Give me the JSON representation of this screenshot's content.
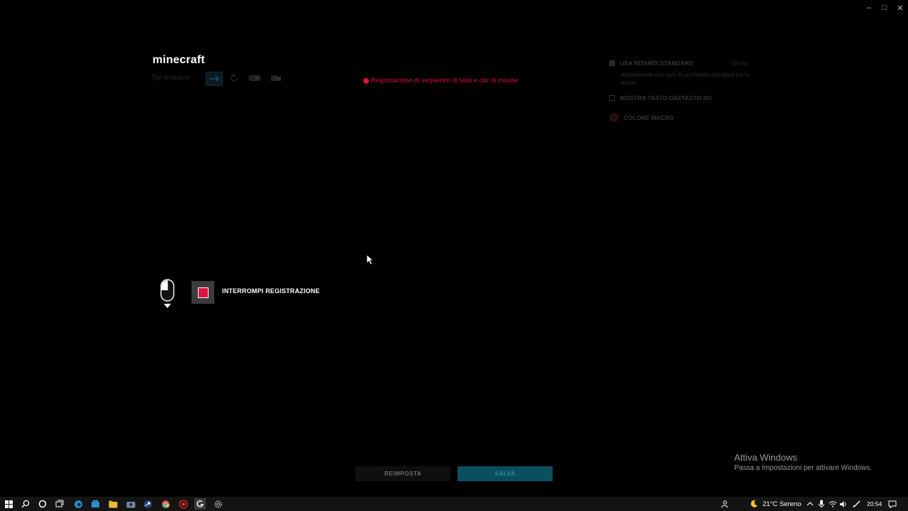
{
  "window": {
    "minimize_label": "–",
    "maximize_label": "□",
    "close_label": "✕"
  },
  "header": {
    "title": "minecraft",
    "macro_types_label": "Tipi di macro",
    "recording_status": "Registrazione di sequenze di tasti e clic di mouse"
  },
  "options": {
    "use_standard_delays_label": "USA RITARDI STANDARD",
    "use_standard_delays_checked": true,
    "delay_value": "50 ms",
    "standard_delays_description": "Attualmente con uso di un ritardo standard tra le azioni",
    "show_key_down_up_label": "MOSTRA TASTO GIÙ/TASTO SU",
    "show_key_down_up_checked": false,
    "macro_color_label": "COLORE MACRO"
  },
  "recording": {
    "stop_label": "INTERROMPI REGISTRAZIONE"
  },
  "footer": {
    "reset_label": "REIMPOSTA",
    "save_label": "SALVA"
  },
  "watermark": {
    "title": "Attiva Windows",
    "subtitle": "Passa a Impostazioni per attivare Windows."
  },
  "taskbar": {
    "weather": "21°C  Sereno",
    "time": "20:54"
  },
  "colors": {
    "accent_red": "#e0103e",
    "save_teal": "#0a4f60"
  }
}
